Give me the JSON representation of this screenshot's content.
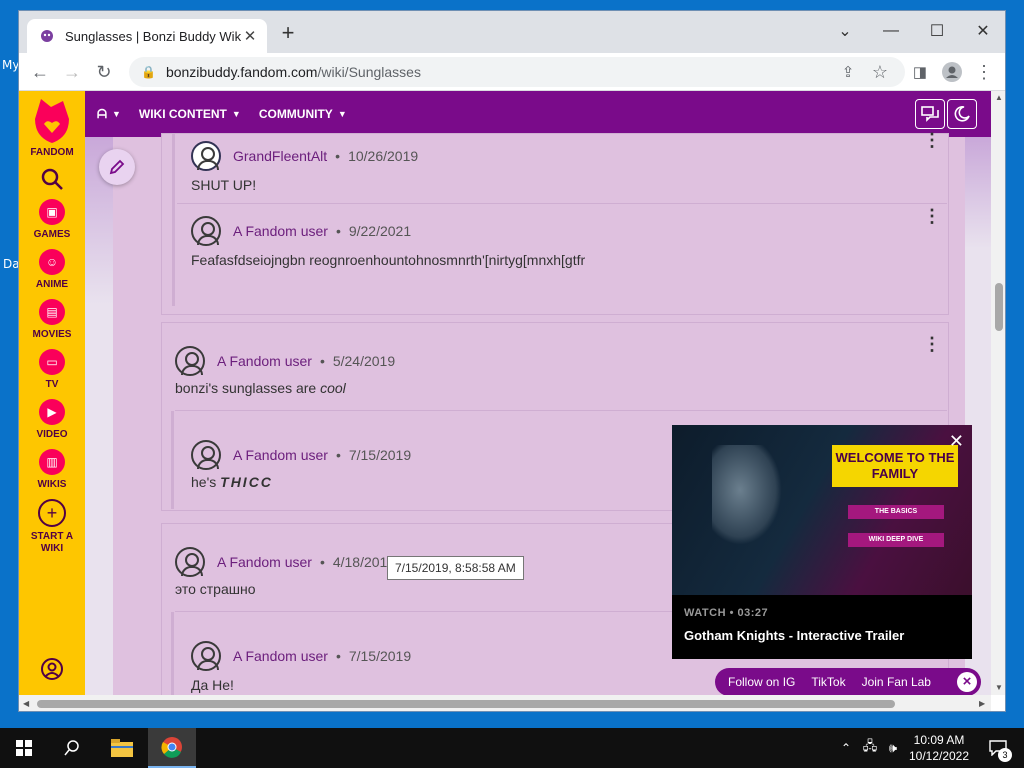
{
  "desktop": {
    "frag1": "My",
    "frag2": "Da"
  },
  "browser": {
    "tab_title": "Sunglasses | Bonzi Buddy Wikia |",
    "new_tab": "+",
    "url_domain": "bonzibuddy.fandom.com",
    "url_path": "/wiki/Sunglasses"
  },
  "fandom_sidebar": {
    "logo_label": "FANDOM",
    "items": [
      "GAMES",
      "ANIME",
      "MOVIES",
      "TV",
      "VIDEO",
      "WIKIS",
      "START A WIKI"
    ]
  },
  "wiki_nav": {
    "home": "ᗩ",
    "items": [
      "WIKI CONTENT",
      "COMMUNITY"
    ]
  },
  "comments": [
    {
      "user": "GrandFleentAlt",
      "date": "10/26/2019",
      "body": "SHUT UP!"
    },
    {
      "user": "A Fandom user",
      "date": "9/22/2021",
      "body": "Feafasfdseiojngbn reognroenhountohnosmnrth'[nirtyg[mnxh[gtfr"
    },
    {
      "user": "A Fandom user",
      "date": "5/24/2019",
      "body_prefix": "bonzi's sunglasses are ",
      "body_em": "cool"
    },
    {
      "user": "A Fandom user",
      "date": "7/15/2019",
      "body_prefix": "he's ",
      "body_em": "THICC"
    },
    {
      "user": "A Fandom user",
      "date": "4/18/2019",
      "body": "это страшно"
    },
    {
      "user": "A Fandom user",
      "date": "7/15/2019",
      "body": "Да Не!"
    }
  ],
  "dot_sep": "•",
  "tooltip": "7/15/2019, 8:58:58 AM",
  "video": {
    "headline": "WELCOME TO THE FAMILY",
    "tag1": "THE BASICS",
    "tag2": "WIKI DEEP DIVE",
    "watch": "WATCH • 03:27",
    "title": "Gotham Knights - Interactive Trailer"
  },
  "social_bar": [
    "Follow on IG",
    "TikTok",
    "Join Fan Lab"
  ],
  "taskbar": {
    "time": "10:09 AM",
    "date": "10/12/2022",
    "notif_count": "3"
  }
}
